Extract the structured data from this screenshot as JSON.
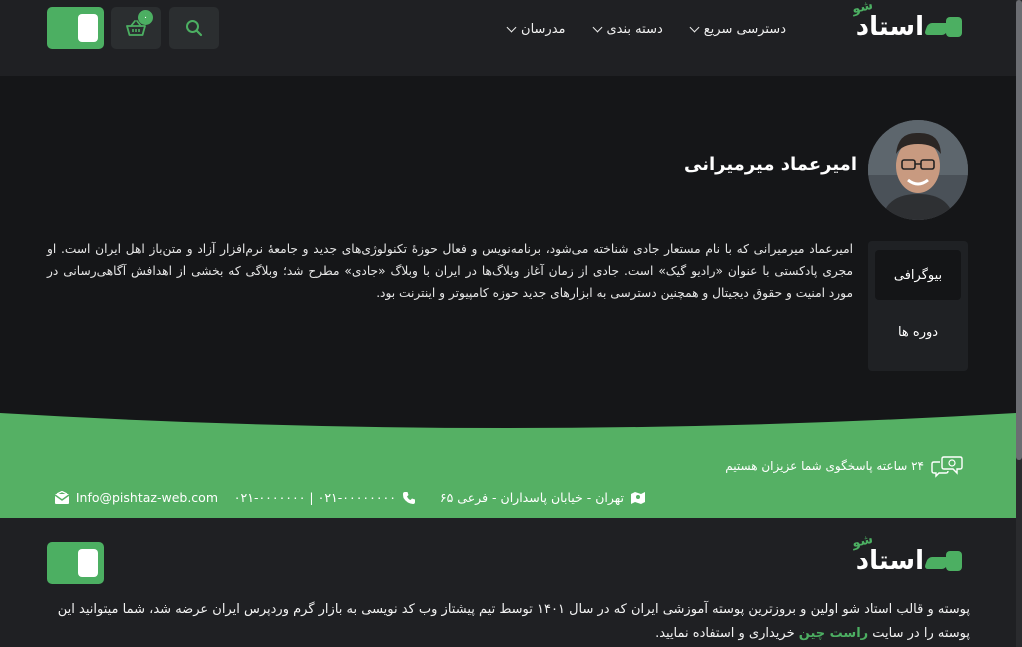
{
  "brand": {
    "name": "استاد",
    "tag": "شو",
    "accent": "#4caf62"
  },
  "header": {
    "nav": [
      {
        "label": "دسترسی سریع"
      },
      {
        "label": "دسته بندی"
      },
      {
        "label": "مدرسان"
      }
    ],
    "cart_count": "۰",
    "icons": {
      "search": "search-icon",
      "cart": "basket-icon",
      "toggle": "theme-toggle"
    }
  },
  "profile": {
    "name": "امیرعماد میرمیرانی",
    "tabs": [
      {
        "label": "بیوگرافی",
        "active": true
      },
      {
        "label": "دوره ها",
        "active": false
      }
    ],
    "bio": "امیرعماد میرمیرانی که با نام مستعار جادی شناخته می‌شود، برنامه‌نویس و فعال حوزهٔ تکنولوژی‌های جدید و جامعهٔ نرم‌افزار آزاد و متن‌باز اهل ایران است. او مجری پادکستی با عنوان «رادیو گیک» است. جادی از زمان آغاز وبلاگ‌ها در ایران با وبلاگ «جادی» مطرح شد؛ وبلاگی که بخشی از اهدافش آگاهی‌رسانی در مورد امنیت و حقوق دیجیتال و همچنین دسترسی به ابزارهای جدید حوزه کامپیوتر و اینترنت بود."
  },
  "contact": {
    "support": "۲۴ ساعته پاسخگوی شما عزیزان هستیم",
    "address": "تهران - خیابان پاسداران - فرعی ۶۵",
    "phone": "۰۲۱-۰۰۰۰۰۰۰۰ | ۰۲۱-۰۰۰۰۰۰۰",
    "email": "Info@pishtaz-web.com"
  },
  "footer": {
    "text_before": "پوسته و قالب استاد شو اولین و بروزترین پوسته آموزشی ایران که در سال ۱۴۰۱ توسط تیم پیشتاز وب کد نویسی به بازار گرم وردپرس ایران عرضه شد، شما میتوانید این پوسته را در سایت",
    "link": "راست چین",
    "text_after": "خریداری و استفاده نمایید."
  }
}
